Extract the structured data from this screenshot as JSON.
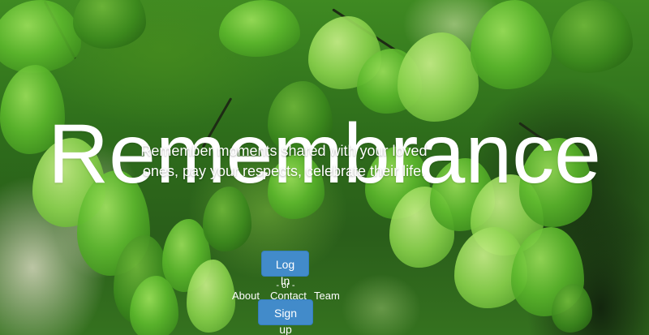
{
  "hero": {
    "title": "Remembrance",
    "tagline": "Remember moments shared with your loved ones, pay your respects, celebrate their life."
  },
  "actions": {
    "login_label": "Log In",
    "separator": "- or -",
    "signup_label": "Sign up"
  },
  "nav": {
    "items": [
      {
        "label": "About"
      },
      {
        "label": "Contact"
      },
      {
        "label": "Team"
      }
    ]
  },
  "colors": {
    "button_primary": "#428bca",
    "text": "#ffffff",
    "background_accent": "#3f8a22"
  }
}
